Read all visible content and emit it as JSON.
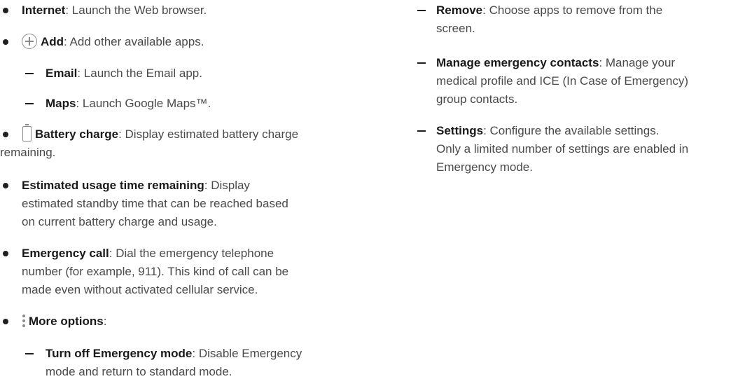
{
  "left_column": {
    "internet": {
      "term": "Internet",
      "desc": ": Launch the Web browser."
    },
    "add": {
      "term": "Add",
      "desc": ": Add other available apps.",
      "icon": "plus-circle-icon"
    },
    "email": {
      "term": "Email",
      "desc": ": Launch the Email app."
    },
    "maps": {
      "term": "Maps",
      "desc": ": Launch Google Maps™."
    },
    "battery": {
      "term": "Battery charge",
      "desc_line1": ": Display estimated battery charge",
      "desc_line2": "remaining.",
      "icon": "battery-icon"
    },
    "usage": {
      "term": "Estimated usage time remaining",
      "desc_line1": ": Display",
      "desc_line2": "estimated standby time that can be reached based",
      "desc_line3": "on current battery charge and usage."
    },
    "emergency_call": {
      "term": "Emergency call",
      "desc_line1": ": Dial the emergency telephone",
      "desc_line2": "number (for example, 911). This kind of call can be",
      "desc_line3": "made even without activated cellular service."
    },
    "more_options": {
      "term": "More options",
      "desc": ":",
      "icon": "more-options-icon"
    },
    "turn_off": {
      "term": "Turn off Emergency mode",
      "desc_line1": ": Disable Emergency",
      "desc_line2": "mode and return to standard mode."
    }
  },
  "right_column": {
    "remove": {
      "term": "Remove",
      "desc_line1": ": Choose apps to remove from the",
      "desc_line2": "screen."
    },
    "manage_contacts": {
      "term": "Manage emergency contacts",
      "desc_line1": ": Manage your",
      "desc_line2": "medical profile and ICE (In Case of Emergency)",
      "desc_line3": "group contacts."
    },
    "settings": {
      "term": "Settings",
      "desc_line1": ": Configure the available settings.",
      "desc_line2": "Only a limited number of settings are enabled in",
      "desc_line3": "Emergency mode."
    }
  }
}
